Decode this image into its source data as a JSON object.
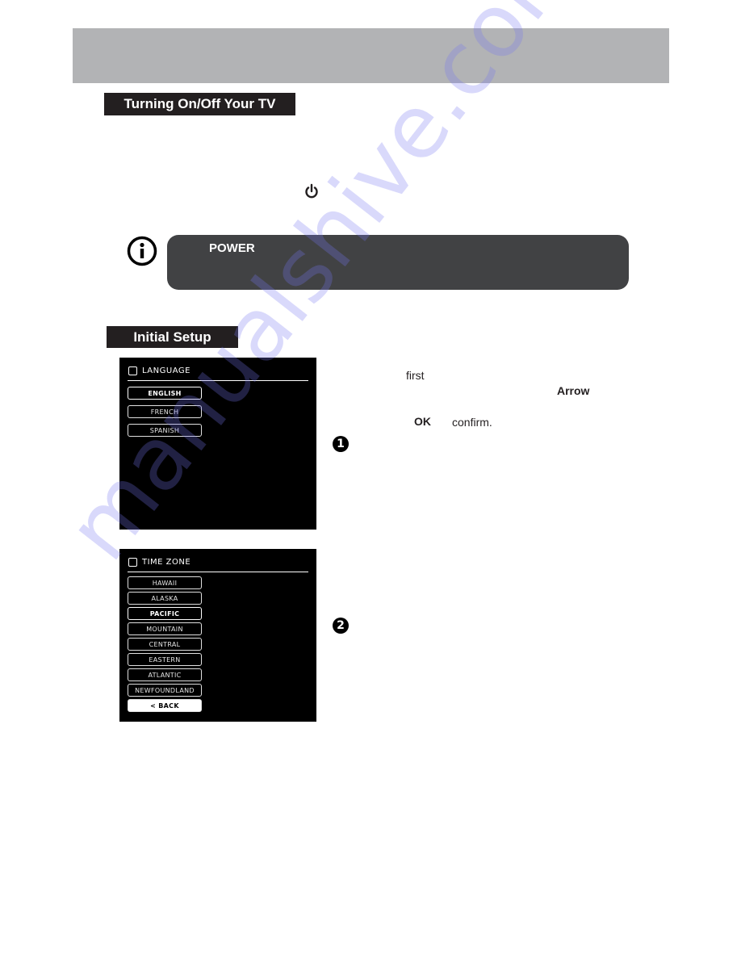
{
  "header": {
    "band_color": "#b2b3b5"
  },
  "sections": {
    "power": {
      "title": "Turning On/Off Your TV",
      "power_icon": "power-icon",
      "note": {
        "icon": "info-icon",
        "keyword": "POWER"
      }
    },
    "setup": {
      "title": "Initial Setup",
      "words": {
        "first": "first",
        "arrow": "Arrow",
        "ok": "OK",
        "confirm": "confirm."
      },
      "steps": [
        {
          "badge": "1"
        },
        {
          "badge": "2"
        }
      ]
    }
  },
  "screens": {
    "language": {
      "heading": "LANGUAGE",
      "options": [
        {
          "label": "ENGLISH",
          "selected": true
        },
        {
          "label": "FRENCH",
          "selected": false
        },
        {
          "label": "SPANISH",
          "selected": false
        }
      ]
    },
    "time_zone": {
      "heading": "TIME ZONE",
      "options": [
        {
          "label": "HAWAII",
          "selected": false
        },
        {
          "label": "ALASKA",
          "selected": false
        },
        {
          "label": "PACIFIC",
          "selected": true
        },
        {
          "label": "MOUNTAIN",
          "selected": false
        },
        {
          "label": "CENTRAL",
          "selected": false
        },
        {
          "label": "EASTERN",
          "selected": false
        },
        {
          "label": "ATLANTIC",
          "selected": false
        },
        {
          "label": "NEWFOUNDLAND",
          "selected": false
        }
      ],
      "back_label": "< BACK"
    }
  },
  "colors": {
    "tag_bg": "#231f20",
    "note_bg": "#414244",
    "screen_bg": "#000000",
    "watermark": "#7878f0"
  },
  "watermark": "manualshive.com"
}
